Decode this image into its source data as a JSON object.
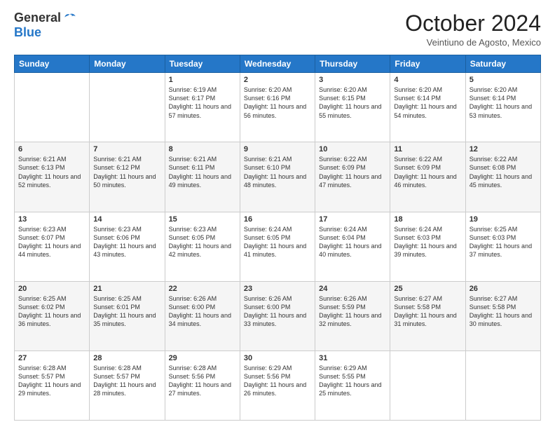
{
  "header": {
    "logo_general": "General",
    "logo_blue": "Blue",
    "title": "October 2024",
    "subtitle": "Veintiuno de Agosto, Mexico"
  },
  "days_header": [
    "Sunday",
    "Monday",
    "Tuesday",
    "Wednesday",
    "Thursday",
    "Friday",
    "Saturday"
  ],
  "weeks": [
    [
      {
        "day": "",
        "text": ""
      },
      {
        "day": "",
        "text": ""
      },
      {
        "day": "1",
        "text": "Sunrise: 6:19 AM\nSunset: 6:17 PM\nDaylight: 11 hours and 57 minutes."
      },
      {
        "day": "2",
        "text": "Sunrise: 6:20 AM\nSunset: 6:16 PM\nDaylight: 11 hours and 56 minutes."
      },
      {
        "day": "3",
        "text": "Sunrise: 6:20 AM\nSunset: 6:15 PM\nDaylight: 11 hours and 55 minutes."
      },
      {
        "day": "4",
        "text": "Sunrise: 6:20 AM\nSunset: 6:14 PM\nDaylight: 11 hours and 54 minutes."
      },
      {
        "day": "5",
        "text": "Sunrise: 6:20 AM\nSunset: 6:14 PM\nDaylight: 11 hours and 53 minutes."
      }
    ],
    [
      {
        "day": "6",
        "text": "Sunrise: 6:21 AM\nSunset: 6:13 PM\nDaylight: 11 hours and 52 minutes."
      },
      {
        "day": "7",
        "text": "Sunrise: 6:21 AM\nSunset: 6:12 PM\nDaylight: 11 hours and 50 minutes."
      },
      {
        "day": "8",
        "text": "Sunrise: 6:21 AM\nSunset: 6:11 PM\nDaylight: 11 hours and 49 minutes."
      },
      {
        "day": "9",
        "text": "Sunrise: 6:21 AM\nSunset: 6:10 PM\nDaylight: 11 hours and 48 minutes."
      },
      {
        "day": "10",
        "text": "Sunrise: 6:22 AM\nSunset: 6:09 PM\nDaylight: 11 hours and 47 minutes."
      },
      {
        "day": "11",
        "text": "Sunrise: 6:22 AM\nSunset: 6:09 PM\nDaylight: 11 hours and 46 minutes."
      },
      {
        "day": "12",
        "text": "Sunrise: 6:22 AM\nSunset: 6:08 PM\nDaylight: 11 hours and 45 minutes."
      }
    ],
    [
      {
        "day": "13",
        "text": "Sunrise: 6:23 AM\nSunset: 6:07 PM\nDaylight: 11 hours and 44 minutes."
      },
      {
        "day": "14",
        "text": "Sunrise: 6:23 AM\nSunset: 6:06 PM\nDaylight: 11 hours and 43 minutes."
      },
      {
        "day": "15",
        "text": "Sunrise: 6:23 AM\nSunset: 6:05 PM\nDaylight: 11 hours and 42 minutes."
      },
      {
        "day": "16",
        "text": "Sunrise: 6:24 AM\nSunset: 6:05 PM\nDaylight: 11 hours and 41 minutes."
      },
      {
        "day": "17",
        "text": "Sunrise: 6:24 AM\nSunset: 6:04 PM\nDaylight: 11 hours and 40 minutes."
      },
      {
        "day": "18",
        "text": "Sunrise: 6:24 AM\nSunset: 6:03 PM\nDaylight: 11 hours and 39 minutes."
      },
      {
        "day": "19",
        "text": "Sunrise: 6:25 AM\nSunset: 6:03 PM\nDaylight: 11 hours and 37 minutes."
      }
    ],
    [
      {
        "day": "20",
        "text": "Sunrise: 6:25 AM\nSunset: 6:02 PM\nDaylight: 11 hours and 36 minutes."
      },
      {
        "day": "21",
        "text": "Sunrise: 6:25 AM\nSunset: 6:01 PM\nDaylight: 11 hours and 35 minutes."
      },
      {
        "day": "22",
        "text": "Sunrise: 6:26 AM\nSunset: 6:00 PM\nDaylight: 11 hours and 34 minutes."
      },
      {
        "day": "23",
        "text": "Sunrise: 6:26 AM\nSunset: 6:00 PM\nDaylight: 11 hours and 33 minutes."
      },
      {
        "day": "24",
        "text": "Sunrise: 6:26 AM\nSunset: 5:59 PM\nDaylight: 11 hours and 32 minutes."
      },
      {
        "day": "25",
        "text": "Sunrise: 6:27 AM\nSunset: 5:58 PM\nDaylight: 11 hours and 31 minutes."
      },
      {
        "day": "26",
        "text": "Sunrise: 6:27 AM\nSunset: 5:58 PM\nDaylight: 11 hours and 30 minutes."
      }
    ],
    [
      {
        "day": "27",
        "text": "Sunrise: 6:28 AM\nSunset: 5:57 PM\nDaylight: 11 hours and 29 minutes."
      },
      {
        "day": "28",
        "text": "Sunrise: 6:28 AM\nSunset: 5:57 PM\nDaylight: 11 hours and 28 minutes."
      },
      {
        "day": "29",
        "text": "Sunrise: 6:28 AM\nSunset: 5:56 PM\nDaylight: 11 hours and 27 minutes."
      },
      {
        "day": "30",
        "text": "Sunrise: 6:29 AM\nSunset: 5:56 PM\nDaylight: 11 hours and 26 minutes."
      },
      {
        "day": "31",
        "text": "Sunrise: 6:29 AM\nSunset: 5:55 PM\nDaylight: 11 hours and 25 minutes."
      },
      {
        "day": "",
        "text": ""
      },
      {
        "day": "",
        "text": ""
      }
    ]
  ]
}
